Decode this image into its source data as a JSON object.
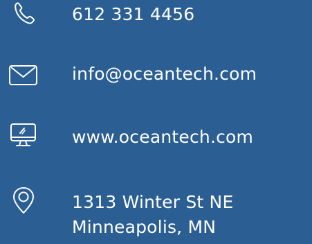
{
  "contact": {
    "phone": {
      "icon": "phone-icon",
      "value": "612 331 4456"
    },
    "email": {
      "icon": "mail-icon",
      "value": "info@oceantech.com"
    },
    "website": {
      "icon": "desktop-monitor-icon",
      "value": "www.oceantech.com"
    },
    "address": {
      "icon": "location-pin-icon",
      "line1": "1313 Winter St NE",
      "line2": "Minneapolis, MN"
    }
  },
  "colors": {
    "background": "#2b5f93",
    "foreground": "#ffffff"
  }
}
